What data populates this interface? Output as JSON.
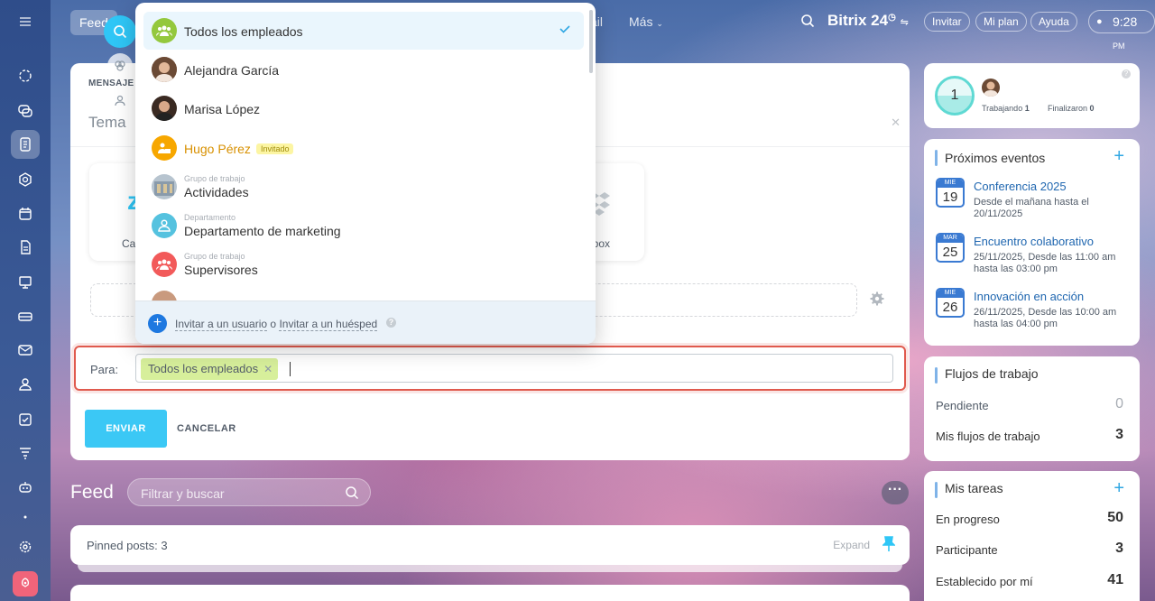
{
  "topbar": {
    "feed_tab": "Feed",
    "mail_fragment": "ail",
    "more": "Más",
    "logo": "Bitrix 24",
    "invite": "Invitar",
    "my_plan": "Mi plan",
    "help": "Ayuda",
    "time": "9:28",
    "ampm": "PM"
  },
  "composer": {
    "tab_label": "MENSAJE",
    "subject_placeholder": "Tema",
    "tile_left_label": "Ca",
    "tile_right_label": "pbox",
    "to_label": "Para:",
    "recipient_chip": "Todos los empleados",
    "send": "ENVIAR",
    "cancel": "CANCELAR"
  },
  "dropdown": {
    "items": [
      {
        "name": "Todos los empleados",
        "type": "all",
        "selected": true
      },
      {
        "name": "Alejandra García",
        "type": "user"
      },
      {
        "name": "Marisa López",
        "type": "user"
      },
      {
        "name": "Hugo Pérez",
        "type": "guest",
        "tag": "Invitado"
      },
      {
        "name": "Actividades",
        "type": "workgroup",
        "sub": "Grupo de trabajo"
      },
      {
        "name": "Departamento de marketing",
        "type": "department",
        "sub": "Departamento"
      },
      {
        "name": "Supervisores",
        "type": "workgroup",
        "sub": "Grupo de trabajo"
      }
    ],
    "footer": {
      "invite_user": "Invitar a un usuario",
      "or": "o",
      "invite_guest": "Invitar a un huésped"
    }
  },
  "feed": {
    "title": "Feed",
    "filter_placeholder": "Filtrar y buscar",
    "pinned_label": "Pinned posts:",
    "pinned_count": "3",
    "expand": "Expand"
  },
  "worktime": {
    "count": "1",
    "working_label": "Trabajando",
    "working_count": "1",
    "finished_label": "Finalizaron",
    "finished_count": "0"
  },
  "events": {
    "title": "Próximos eventos",
    "items": [
      {
        "month": "MIÉ",
        "day": "19",
        "title": "Conferencia 2025",
        "desc": "Desde el mañana hasta el 20/11/2025"
      },
      {
        "month": "MAR",
        "day": "25",
        "title": "Encuentro colaborativo",
        "desc": "25/11/2025, Desde las 11:00 am hasta las 03:00 pm"
      },
      {
        "month": "MIÉ",
        "day": "26",
        "title": "Innovación en acción",
        "desc": "26/11/2025, Desde las 10:00 am hasta las 04:00 pm"
      }
    ]
  },
  "workflows": {
    "title": "Flujos de trabajo",
    "pending_label": "Pendiente",
    "pending_value": "0",
    "mine_label": "Mis flujos de trabajo",
    "mine_value": "3"
  },
  "tasks": {
    "title": "Mis tareas",
    "in_progress_label": "En progreso",
    "in_progress_value": "50",
    "participant_label": "Participante",
    "participant_value": "3",
    "set_by_me_label": "Establecido por mí",
    "set_by_me_value": "41"
  },
  "colors": {
    "accent": "#2fc6f6",
    "send_button": "#3bc8f5",
    "chip": "#d7ef9b",
    "highlight_border": "#e05a4e"
  }
}
